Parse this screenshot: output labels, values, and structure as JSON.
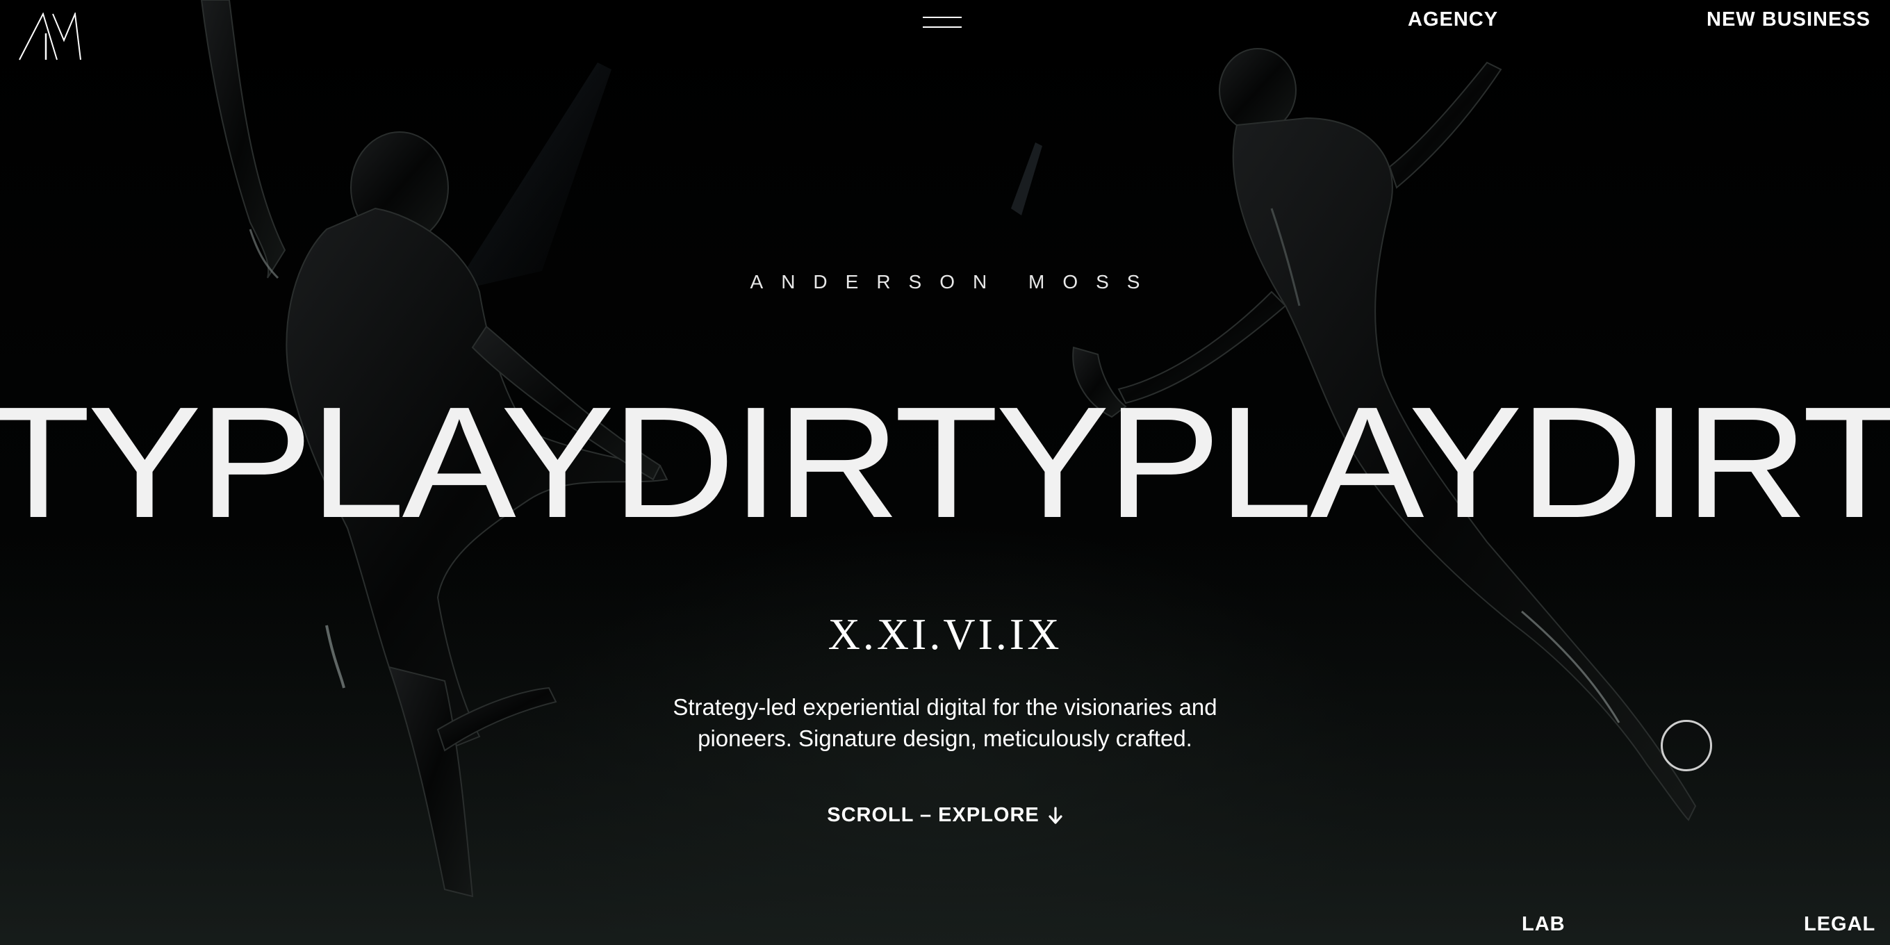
{
  "header": {
    "logo_text": "AM",
    "nav": {
      "agency": "AGENCY",
      "new_business": "NEW BUSINESS"
    },
    "menu_icon": "hamburger-icon"
  },
  "hero": {
    "brand_name": "ANDERSON MOSS",
    "marquee_words": [
      "DIRTY",
      "PLAY"
    ],
    "marquee_text": "TYPLAYDIRTYPLAYDIRTYPL",
    "date_roman": "X.XI.VI.IX",
    "tagline_line1": "Strategy-led experiential digital for the visionaries and",
    "tagline_line2": "pioneers. Signature design, meticulously crafted.",
    "scroll_label": "SCROLL – EXPLORE",
    "scroll_icon": "arrow-down-icon"
  },
  "footer": {
    "lab": "LAB",
    "legal": "LEGAL"
  },
  "colors": {
    "background": "#000000",
    "text": "#ffffff",
    "figure": "#0b0d0c"
  }
}
